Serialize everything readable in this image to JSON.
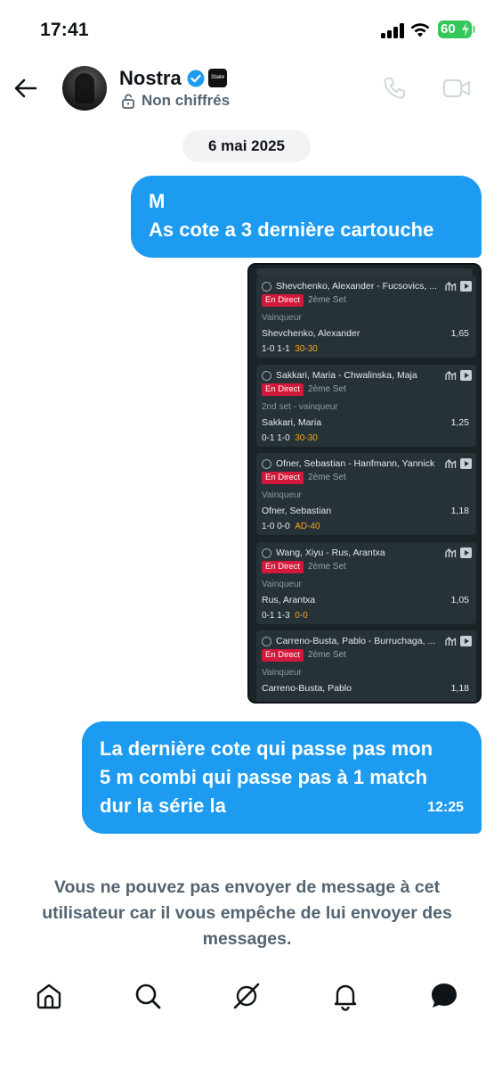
{
  "status_bar": {
    "time": "17:41",
    "battery": "60"
  },
  "header": {
    "contact_name": "Nostra",
    "affiliate_badge": "Stake",
    "encryption_status": "Non chiffrés"
  },
  "conversation": {
    "date": "6 mai 2025",
    "messages": [
      {
        "lines": [
          "M",
          "As cote a 3 dernière cartouche"
        ]
      },
      {
        "lines": [
          "La dernière cote qui passe pas mon",
          "5 m combi qui passe pas à 1 match",
          "dur  la série la"
        ],
        "time": "12:25"
      }
    ]
  },
  "bet_slip": {
    "live_label": "En Direct",
    "bets": [
      {
        "match": "Shevchenko, Alexander - Fucsovics, ...",
        "set": "2ème Set",
        "market": "Vainqueur",
        "selection": "Shevchenko, Alexander",
        "odds": "1,65",
        "score_sets": "1-0  1-1",
        "score_live": "30-30"
      },
      {
        "match": "Sakkari, Maria - Chwalinska, Maja",
        "set": "2ème Set",
        "market": "2nd set - vainqueur",
        "selection": "Sakkari, Maria",
        "odds": "1,25",
        "score_sets": "0-1  1-0",
        "score_live": "30-30"
      },
      {
        "match": "Ofner, Sebastian - Hanfmann, Yannick",
        "set": "2ème Set",
        "market": "Vainqueur",
        "selection": "Ofner, Sebastian",
        "odds": "1,18",
        "score_sets": "1-0  0-0",
        "score_live": "AD-40"
      },
      {
        "match": "Wang, Xiyu - Rus, Arantxa",
        "set": "2ème Set",
        "market": "Vainqueur",
        "selection": "Rus, Arantxa",
        "odds": "1,05",
        "score_sets": "0-1  1-3",
        "score_live": "0-0"
      },
      {
        "match": "Carreno-Busta, Pablo - Burruchaga, ...",
        "set": "2ème Set",
        "market": "Vainqueur",
        "selection": "Carreno-Busta, Pablo",
        "odds": "1,18",
        "score_sets": "",
        "score_live": ""
      }
    ]
  },
  "blocked_notice": "Vous ne pouvez pas envoyer de message à cet utilisateur car il vous empêche de lui envoyer des messages.",
  "nav": {
    "items": [
      {
        "icon": "home-icon"
      },
      {
        "icon": "search-icon"
      },
      {
        "icon": "grok-icon"
      },
      {
        "icon": "bell-icon"
      },
      {
        "icon": "messages-icon"
      }
    ]
  },
  "colors": {
    "accent": "#1d9bf0",
    "muted": "#536471",
    "live_red": "#d3183a",
    "score_orange": "#f5a623"
  }
}
